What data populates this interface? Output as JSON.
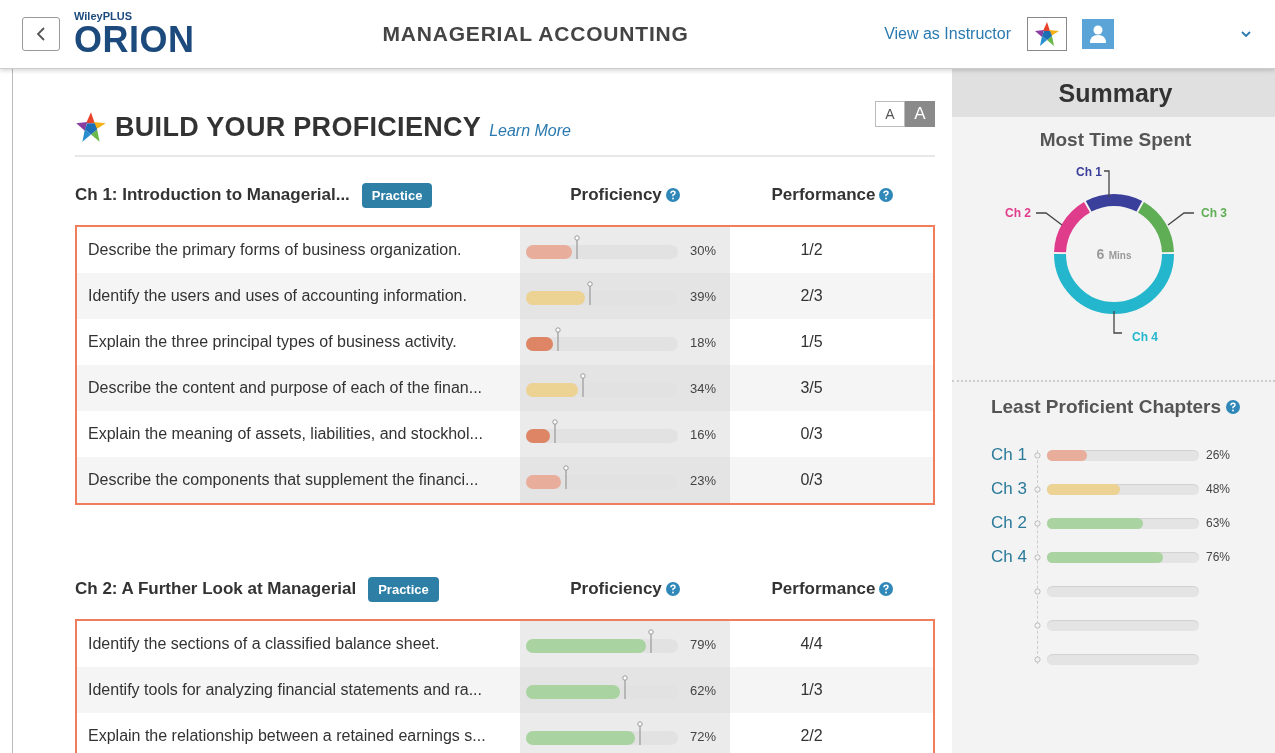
{
  "header": {
    "brand_top": "WileyPLUS",
    "brand": "ORION",
    "course_title": "MANAGERIAL ACCOUNTING",
    "instructor_link": "View as Instructor"
  },
  "main": {
    "title": "BUILD YOUR PROFICIENCY",
    "learn_more": "Learn More",
    "text_size_options": [
      {
        "label": "A",
        "selected": false
      },
      {
        "label": "A",
        "selected": true
      }
    ],
    "chapters": [
      {
        "title": "Ch 1: Introduction to Managerial...",
        "practice": "Practice",
        "proficiency_heading": "Proficiency",
        "performance_heading": "Performance",
        "objectives": [
          {
            "text": "Describe the primary forms of business organization.",
            "level": 0.3,
            "percent": "30%",
            "performance": "1/2"
          },
          {
            "text": "Identify the users and uses of accounting information.",
            "level": 0.39,
            "percent": "39%",
            "performance": "2/3"
          },
          {
            "text": "Explain the three principal types of business activity.",
            "level": 0.18,
            "percent": "18%",
            "performance": "1/5"
          },
          {
            "text": "Describe the content and purpose of each of the finan...",
            "level": 0.34,
            "percent": "34%",
            "performance": "3/5"
          },
          {
            "text": "Explain the meaning of assets, liabilities, and stockhol...",
            "level": 0.16,
            "percent": "16%",
            "performance": "0/3"
          },
          {
            "text": "Describe the components that supplement the financi...",
            "level": 0.23,
            "percent": "23%",
            "performance": "0/3"
          }
        ]
      },
      {
        "title": "Ch 2: A Further Look at Managerial",
        "practice": "Practice",
        "proficiency_heading": "Proficiency",
        "performance_heading": "Performance",
        "objectives": [
          {
            "text": "Identify the sections of a classified balance sheet.",
            "level": 0.79,
            "percent": "79%",
            "performance": "4/4"
          },
          {
            "text": "Identify tools for analyzing financial statements and ra...",
            "level": 0.62,
            "percent": "62%",
            "performance": "1/3"
          },
          {
            "text": "Explain the relationship between a retained earnings s...",
            "level": 0.72,
            "percent": "72%",
            "performance": "2/2"
          }
        ]
      }
    ]
  },
  "summary": {
    "title": "Summary",
    "time_title": "Most Time Spent",
    "center_value": "6",
    "center_unit": "Mins",
    "segments": [
      {
        "label": "Ch 1",
        "color": "#3b3f9c"
      },
      {
        "label": "Ch 2",
        "color": "#e03c8c"
      },
      {
        "label": "Ch 3",
        "color": "#5fae55"
      },
      {
        "label": "Ch 4",
        "color": "#23b6cc"
      }
    ],
    "least_title": "Least Proficient Chapters",
    "chapters": [
      {
        "label": "Ch 1",
        "level": 0.26,
        "percent": "26%"
      },
      {
        "label": "Ch 3",
        "level": 0.48,
        "percent": "48%"
      },
      {
        "label": "Ch 2",
        "level": 0.63,
        "percent": "63%"
      },
      {
        "label": "Ch 4",
        "level": 0.76,
        "percent": "76%"
      }
    ]
  }
}
